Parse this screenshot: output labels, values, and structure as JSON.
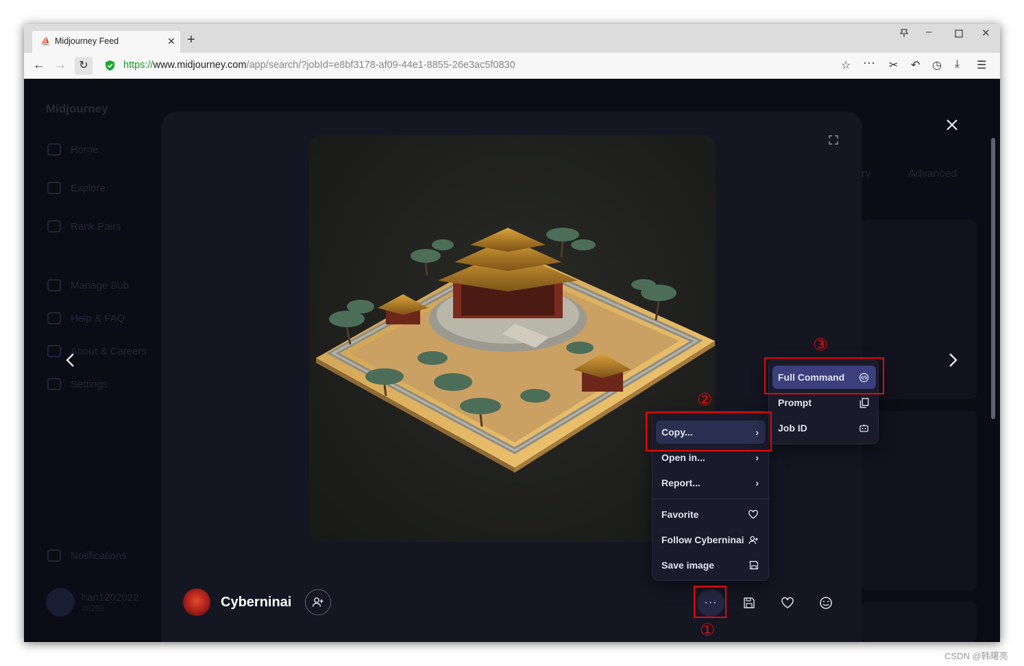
{
  "browser": {
    "tab_title": "Midjourney Feed",
    "url_protocol": "https://",
    "url_host": "www.midjourney.com",
    "url_path": "/app/search/?jobId=e8bf3178-af09-44e1-8855-26e3ac5f0830"
  },
  "background": {
    "brand": "Midjourney",
    "nav": [
      {
        "label": "Home"
      },
      {
        "label": "Explore"
      },
      {
        "label": "Rank Pairs"
      },
      {
        "label": "Manage Sub"
      },
      {
        "label": "Help & FAQ"
      },
      {
        "label": "About & Careers"
      },
      {
        "label": "Settings"
      }
    ],
    "notifications": "Notifications",
    "user_name": "han1202022",
    "user_tag": "#8288",
    "tab_partial": "ry",
    "tab_advanced": "Advanced"
  },
  "modal": {
    "author_name": "Cyberninai"
  },
  "menu": {
    "items": [
      {
        "label": "Copy..."
      },
      {
        "label": "Open in..."
      },
      {
        "label": "Report..."
      },
      {
        "label": "Favorite"
      },
      {
        "label": "Follow Cyberninai"
      },
      {
        "label": "Save image"
      }
    ]
  },
  "submenu": {
    "items": [
      {
        "label": "Full Command"
      },
      {
        "label": "Prompt"
      },
      {
        "label": "Job ID"
      }
    ]
  },
  "annotations": {
    "one": "①",
    "two": "②",
    "three": "③"
  },
  "watermark": "CSDN @韩曙亮",
  "colors": {
    "accent": "#3b3f7c",
    "annotation": "#e3090b",
    "modal_bg": "#141622"
  }
}
